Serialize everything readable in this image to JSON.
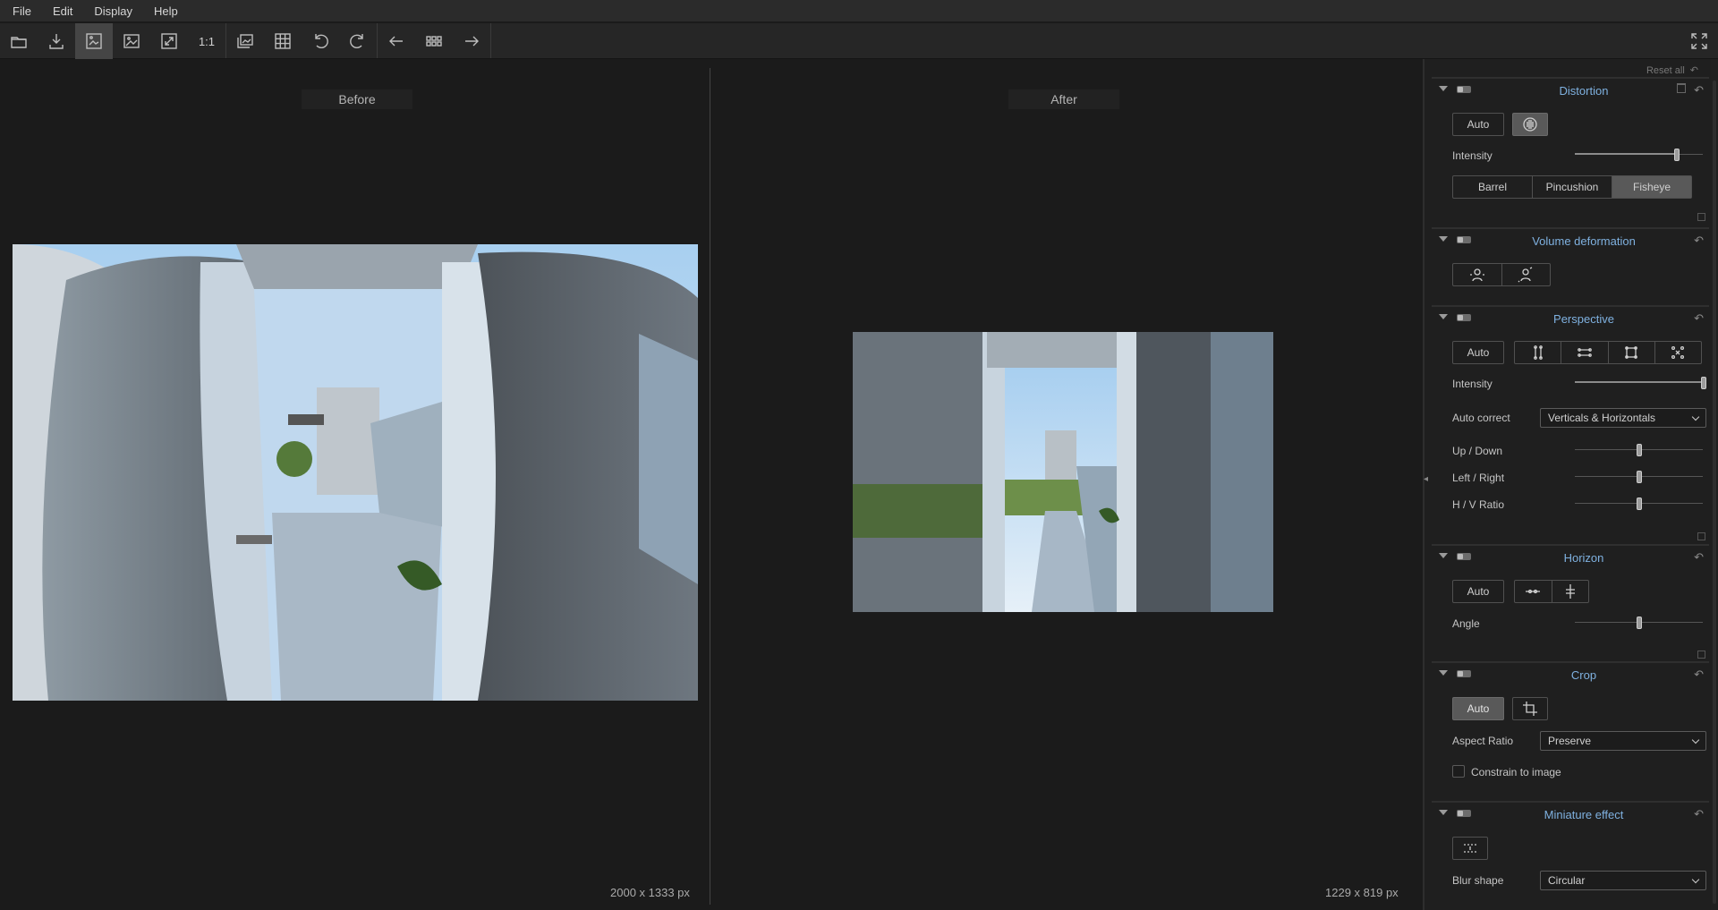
{
  "menu": [
    "File",
    "Edit",
    "Display",
    "Help"
  ],
  "toolbar": {
    "one_to_one": "1:1"
  },
  "view": {
    "before_label": "Before",
    "after_label": "After",
    "before_dims": "2000 x 1333 px",
    "after_dims": "1229 x 819 px"
  },
  "panel": {
    "reset_all": "Reset all",
    "distortion": {
      "title": "Distortion",
      "auto": "Auto",
      "intensity_label": "Intensity",
      "intensity_value": 0.8,
      "modes": [
        "Barrel",
        "Pincushion",
        "Fisheye"
      ],
      "selected_mode": "Fisheye"
    },
    "volume": {
      "title": "Volume deformation"
    },
    "perspective": {
      "title": "Perspective",
      "auto": "Auto",
      "intensity_label": "Intensity",
      "intensity_value": 1.0,
      "auto_correct_label": "Auto correct",
      "auto_correct_value": "Verticals & Horizontals",
      "updown_label": "Up / Down",
      "updown_value": 0.5,
      "leftright_label": "Left / Right",
      "leftright_value": 0.5,
      "hv_label": "H / V Ratio",
      "hv_value": 0.5
    },
    "horizon": {
      "title": "Horizon",
      "auto": "Auto",
      "angle_label": "Angle",
      "angle_value": 0.5
    },
    "crop": {
      "title": "Crop",
      "auto": "Auto",
      "aspect_label": "Aspect Ratio",
      "aspect_value": "Preserve",
      "constrain_label": "Constrain to image"
    },
    "miniature": {
      "title": "Miniature effect",
      "blur_shape_label": "Blur shape",
      "blur_shape_value": "Circular"
    }
  },
  "colors": {
    "accent_title": "#7fb1e0",
    "background": "#1b1b1b",
    "panel": "#1f1f1f"
  }
}
